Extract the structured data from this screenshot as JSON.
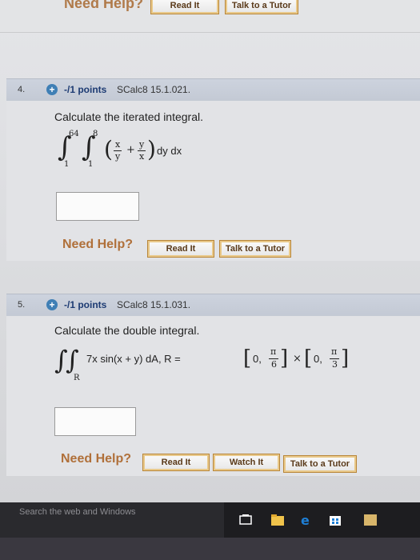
{
  "top_section": {
    "need_help_label": "Need Help?",
    "buttons": [
      "Read It",
      "Talk to a Tutor"
    ]
  },
  "questions": [
    {
      "number": "4.",
      "points": "-/1 points",
      "source": "SCalc8 15.1.021.",
      "prompt": "Calculate the iterated integral.",
      "math": {
        "outer_upper": "64",
        "outer_lower": "1",
        "inner_upper": "8",
        "inner_lower": "1",
        "integrand": "(x/y + y/x) dy dx",
        "frac1_num": "x",
        "frac1_den": "y",
        "frac2_num": "y",
        "frac2_den": "x",
        "tail": "dy dx"
      },
      "need_help_label": "Need Help?",
      "buttons": [
        "Read It",
        "Talk to a Tutor"
      ]
    },
    {
      "number": "5.",
      "points": "-/1 points",
      "source": "SCalc8 15.1.031.",
      "prompt": "Calculate the double integral.",
      "math": {
        "region": "R",
        "integrand": "7x sin(x + y) dA, R =",
        "interval1_left": "0,",
        "interval1_num": "π",
        "interval1_den": "6",
        "times": "×",
        "interval2_left": "0,",
        "interval2_num": "π",
        "interval2_den": "3"
      },
      "need_help_label": "Need Help?",
      "buttons": [
        "Read It",
        "Watch It",
        "Talk to a Tutor"
      ]
    }
  ],
  "taskbar": {
    "search_placeholder": "Search the web and Windows",
    "icons": [
      "task-view-icon",
      "file-explorer-icon",
      "edge-icon",
      "store-icon",
      "app-icon"
    ]
  },
  "colors": {
    "need_help": "#b0703a",
    "points": "#1d3b73",
    "header_bg": "#c6ccd7",
    "button_border": "#b8863a"
  }
}
